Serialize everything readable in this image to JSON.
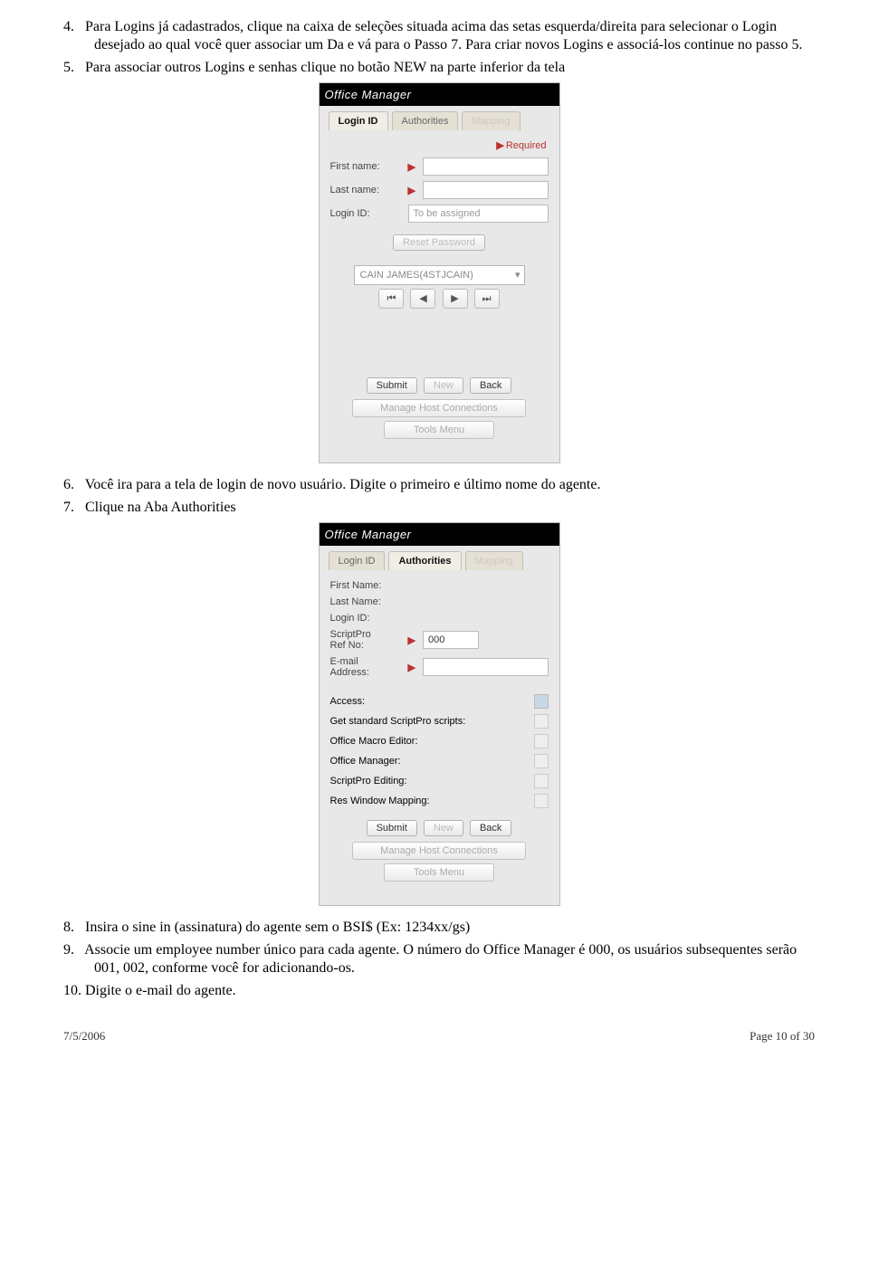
{
  "list": {
    "i4": {
      "num": "4.",
      "text": "Para Logins já cadastrados, clique na caixa de seleções situada acima das setas esquerda/direita para selecionar o Login desejado ao qual você quer associar um Da e vá para o Passo 7. Para criar novos Logins e associá-los continue no passo 5."
    },
    "i5": {
      "num": "5.",
      "text": "Para associar outros Logins e senhas clique no botão NEW na parte inferior da tela"
    },
    "i6": {
      "num": "6.",
      "text": "Você ira para a tela de login de novo usuário. Digite o primeiro e último nome do agente."
    },
    "i7": {
      "num": "7.",
      "text": "Clique na Aba Authorities"
    },
    "i8": {
      "num": "8.",
      "text": "Insira o sine in (assinatura) do agente sem o BSI$ (Ex: 1234xx/gs)"
    },
    "i9": {
      "num": "9.",
      "text": "Associe um employee number único para cada agente. O número do Office Manager é 000, os usuários subsequentes serão 001, 002, conforme você for adicionando-os."
    },
    "i10": {
      "num": "10.",
      "text": "Digite o e-mail do agente."
    }
  },
  "shot1": {
    "title": "Office Manager",
    "tabs": {
      "login": "Login ID",
      "auth": "Authorities",
      "map": "Mapping"
    },
    "required": "Required",
    "fields": {
      "firstname": "First name:",
      "lastname": "Last name:",
      "loginid": "Login ID:",
      "loginid_value": "To be assigned"
    },
    "resetpw": "Reset Password",
    "dd": "CAIN JAMES(4STJCAIN)",
    "nav": {
      "first": "⏮",
      "prev": "◀",
      "next": "▶",
      "last": "⏭"
    },
    "btns": {
      "submit": "Submit",
      "new": "New",
      "back": "Back",
      "host": "Manage Host Connections",
      "tools": "Tools Menu"
    }
  },
  "shot2": {
    "title": "Office Manager",
    "tabs": {
      "login": "Login ID",
      "auth": "Authorities",
      "map": "Mapping"
    },
    "fields": {
      "firstname": "First Name:",
      "lastname": "Last Name:",
      "loginid": "Login ID:",
      "refno": "ScriptPro\nRef No:",
      "refno_value": "000",
      "email": "E-mail\nAddress:"
    },
    "checks": {
      "access": "Access:",
      "stdscripts": "Get standard ScriptPro scripts:",
      "macro": "Office Macro Editor:",
      "om": "Office Manager:",
      "spedit": "ScriptPro Editing:",
      "reswin": "Res Window Mapping:"
    },
    "btns": {
      "submit": "Submit",
      "new": "New",
      "back": "Back",
      "host": "Manage Host Connections",
      "tools": "Tools Menu"
    }
  },
  "footer": {
    "date": "7/5/2006",
    "page": "Page 10 of 30"
  }
}
